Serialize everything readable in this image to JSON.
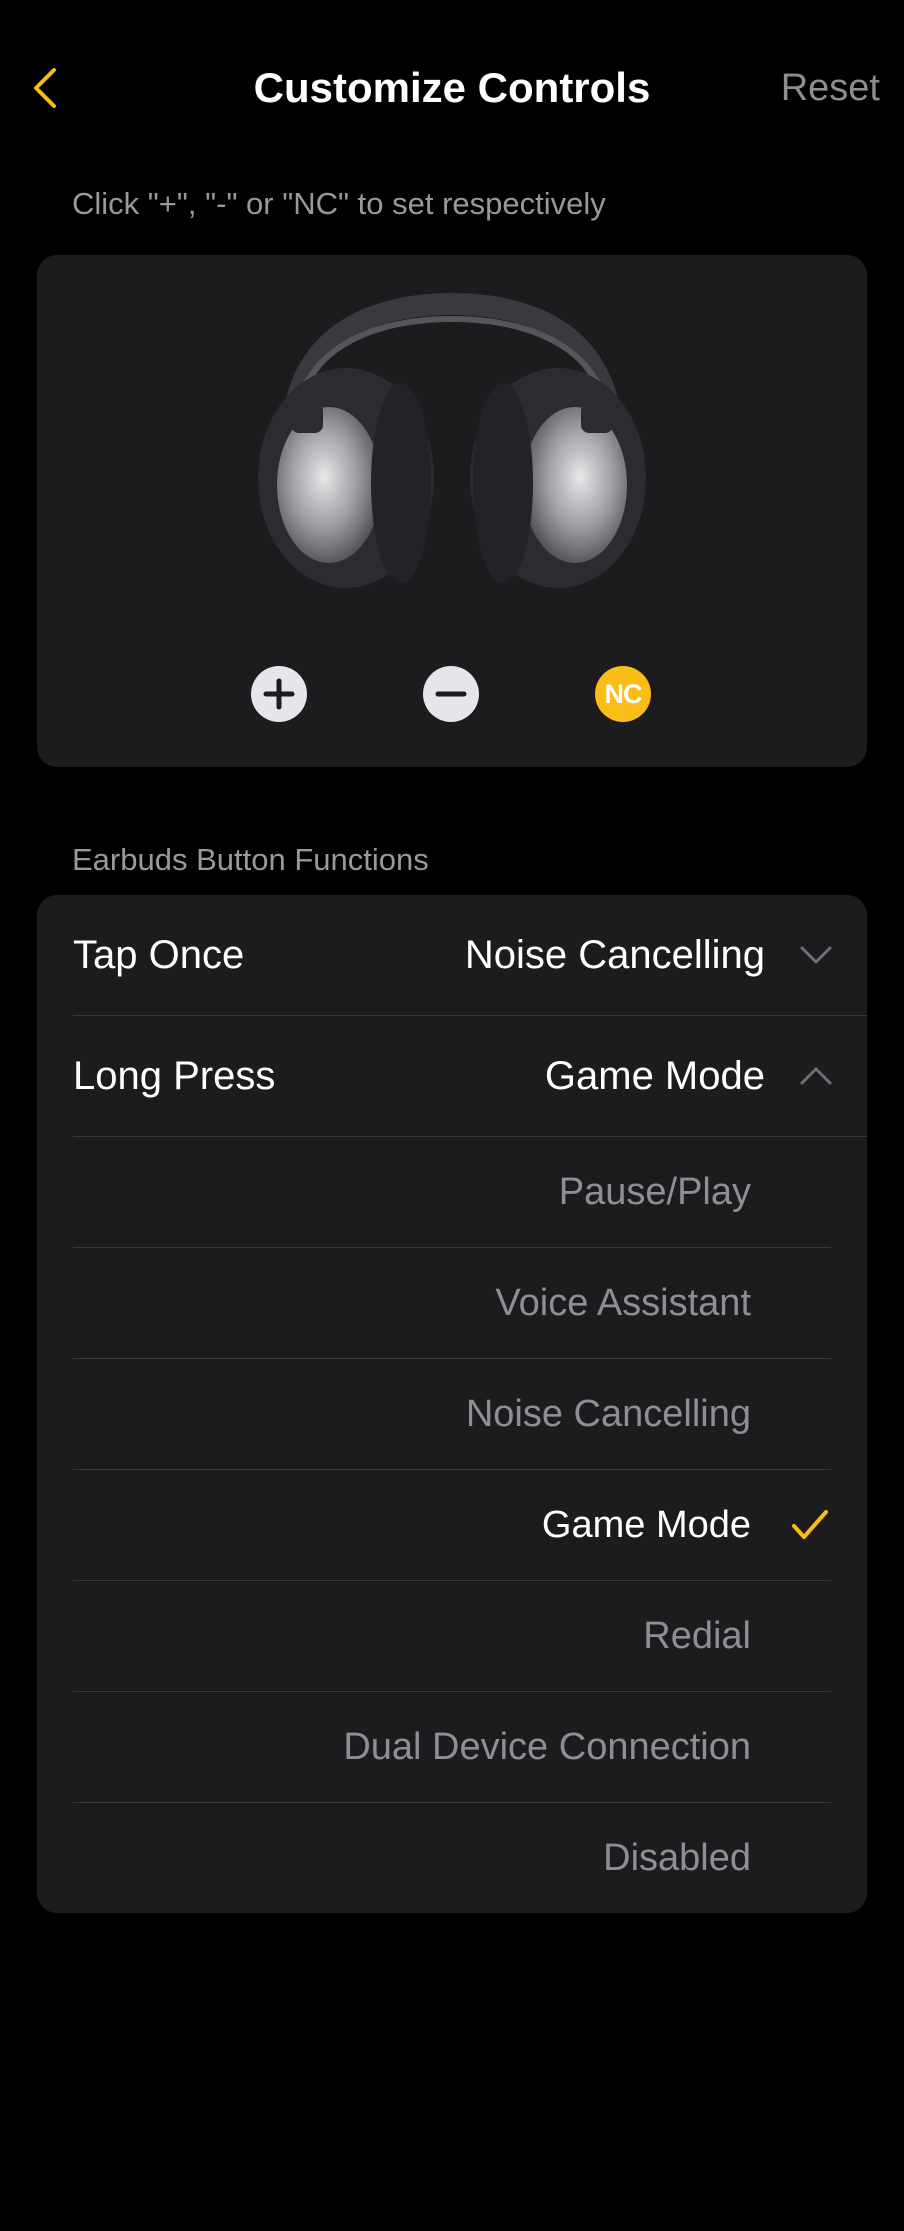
{
  "header": {
    "title": "Customize Controls",
    "reset_label": "Reset"
  },
  "hint": "Click \"+\", \"-\" or \"NC\" to set respectively",
  "device": {
    "controls": [
      {
        "name": "plus",
        "icon": "plus-icon"
      },
      {
        "name": "minus",
        "icon": "minus-icon"
      },
      {
        "name": "nc",
        "label": "NC"
      }
    ]
  },
  "section_label": "Earbuds Button Functions",
  "functions": {
    "tap_once": {
      "label": "Tap Once",
      "value": "Noise Cancelling",
      "expanded": false
    },
    "long_press": {
      "label": "Long Press",
      "value": "Game Mode",
      "expanded": true
    },
    "options": [
      {
        "label": "Pause/Play",
        "selected": false
      },
      {
        "label": "Voice Assistant",
        "selected": false
      },
      {
        "label": "Noise Cancelling",
        "selected": false
      },
      {
        "label": "Game Mode",
        "selected": true
      },
      {
        "label": "Redial",
        "selected": false
      },
      {
        "label": "Dual Device Connection",
        "selected": false
      },
      {
        "label": "Disabled",
        "selected": false
      }
    ]
  },
  "colors": {
    "accent": "#f9bd17",
    "background": "#000000",
    "card": "#1c1c1e",
    "separator": "#3a3a3c",
    "secondary_text": "#98989d"
  }
}
